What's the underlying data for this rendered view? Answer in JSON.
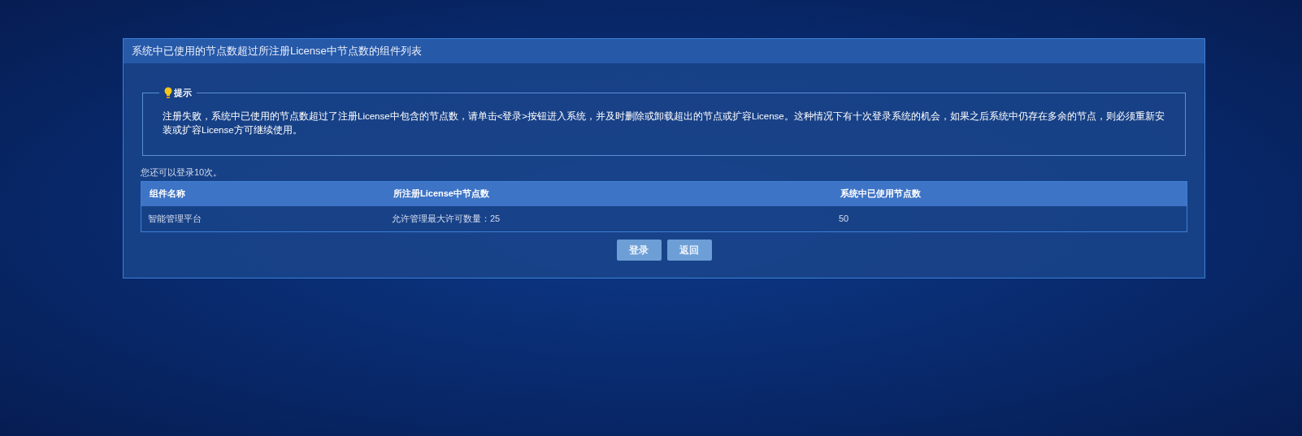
{
  "dialog": {
    "title": "系统中已使用的节点数超过所注册License中节点数的组件列表",
    "notice": {
      "legend": "提示",
      "message": "注册失败，系统中已使用的节点数超过了注册License中包含的节点数，请单击<登录>按钮进入系统，并及时删除或卸载超出的节点或扩容License。这种情况下有十次登录系统的机会，如果之后系统中仍存在多余的节点，则必须重新安装或扩容License方可继续使用。"
    },
    "remaining": "您还可以登录10次。",
    "table": {
      "columns": [
        "组件名称",
        "所注册License中节点数",
        "系统中已使用节点数"
      ],
      "rows": [
        [
          "智能管理平台",
          "允许管理最大许可数量：25",
          "50"
        ]
      ]
    },
    "buttons": [
      "登录",
      "返回"
    ]
  }
}
